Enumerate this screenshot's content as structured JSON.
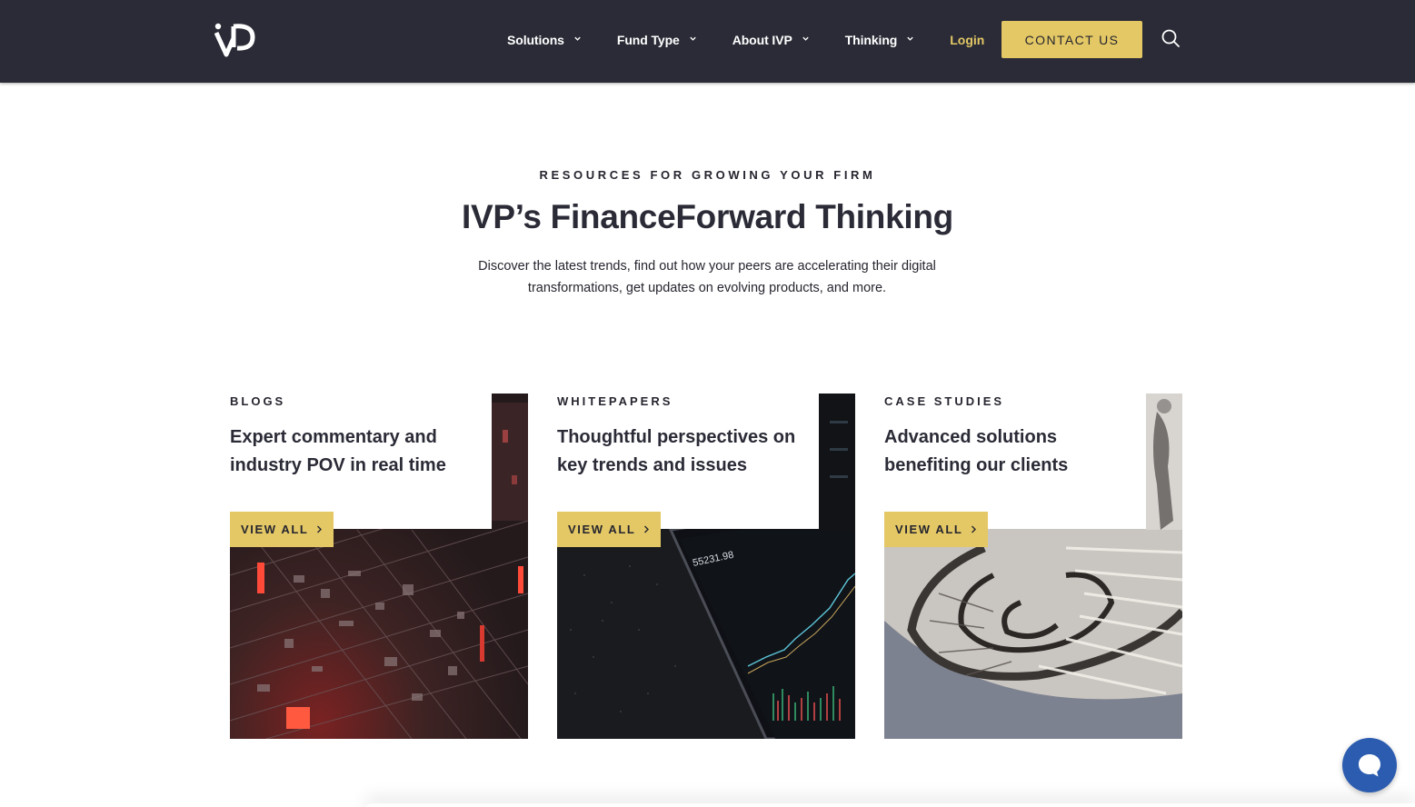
{
  "brand": {
    "logo_icon": "ivp-logo-icon",
    "accent": "#e4c865",
    "header_bg": "#2a2b36"
  },
  "nav": {
    "items": [
      {
        "label": "Solutions",
        "icon": "chevron-down-icon"
      },
      {
        "label": "Fund Type",
        "icon": "chevron-down-icon"
      },
      {
        "label": "About IVP",
        "icon": "chevron-down-icon"
      },
      {
        "label": "Thinking",
        "icon": "chevron-down-icon"
      }
    ],
    "login": "Login",
    "contact": "CONTACT US",
    "search_icon": "search-icon"
  },
  "intro": {
    "eyebrow": "RESOURCES FOR GROWING YOUR FIRM",
    "title": "IVP’s FinanceForward Thinking",
    "text": "Discover the latest trends, find out how your peers are accelerating their digital transformations, get updates on evolving products, and more."
  },
  "cards": [
    {
      "label": "BLOGS",
      "heading": "Expert commentary and industry POV in real time",
      "cta": "VIEW ALL",
      "image": "circuit-board-image"
    },
    {
      "label": "WHITEPAPERS",
      "heading": "Thoughtful perspectives on key trends and issues",
      "cta": "VIEW ALL",
      "image": "stock-chart-phone-image",
      "image_text": "55231.98"
    },
    {
      "label": "CASE STUDIES",
      "heading": "Advanced solutions benefiting our clients",
      "cta": "VIEW ALL",
      "image": "spiral-staircase-image"
    }
  ],
  "chat": {
    "icon": "chat-bubble-icon",
    "color": "#2c5cb0"
  }
}
